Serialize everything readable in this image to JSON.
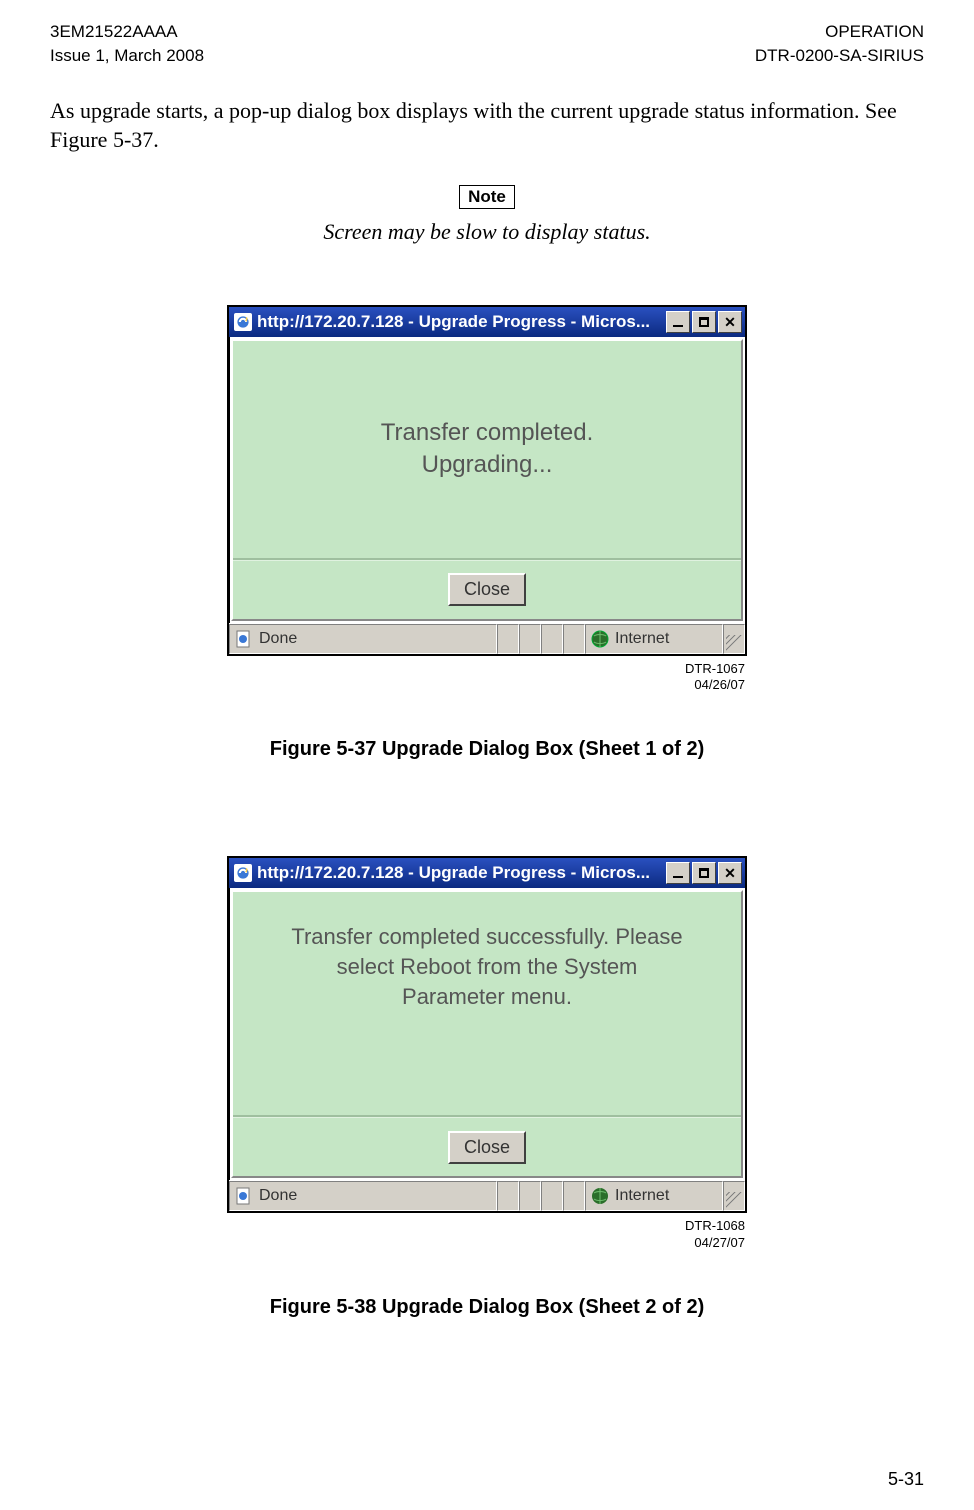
{
  "header": {
    "left_line1": "3EM21522AAAA",
    "left_line2": "Issue 1, March 2008",
    "right_line1": "OPERATION",
    "right_line2": "DTR-0200-SA-SIRIUS"
  },
  "body_para": "As upgrade starts, a pop-up dialog box displays with the current upgrade status information. See Figure 5-37.",
  "note_label": "Note",
  "note_text": "Screen may be slow to display status.",
  "dialog1": {
    "title": "http://172.20.7.128 - Upgrade Progress - Micros...",
    "msg_line1": "Transfer completed.",
    "msg_line2": "Upgrading...",
    "close_label": "Close",
    "status_done": "Done",
    "status_zone": "Internet",
    "meta_line1": "DTR-1067",
    "meta_line2": "04/26/07",
    "caption": "Figure 5-37  Upgrade Dialog Box (Sheet 1 of 2)"
  },
  "dialog2": {
    "title": "http://172.20.7.128 - Upgrade Progress - Micros...",
    "msg_line1": "Transfer completed successfully. Please",
    "msg_line2": "select Reboot from the System",
    "msg_line3": "Parameter menu.",
    "close_label": "Close",
    "status_done": "Done",
    "status_zone": "Internet",
    "meta_line1": "DTR-1068",
    "meta_line2": "04/27/07",
    "caption": "Figure 5-38  Upgrade Dialog Box (Sheet 2 of 2)"
  },
  "page_number": "5-31"
}
